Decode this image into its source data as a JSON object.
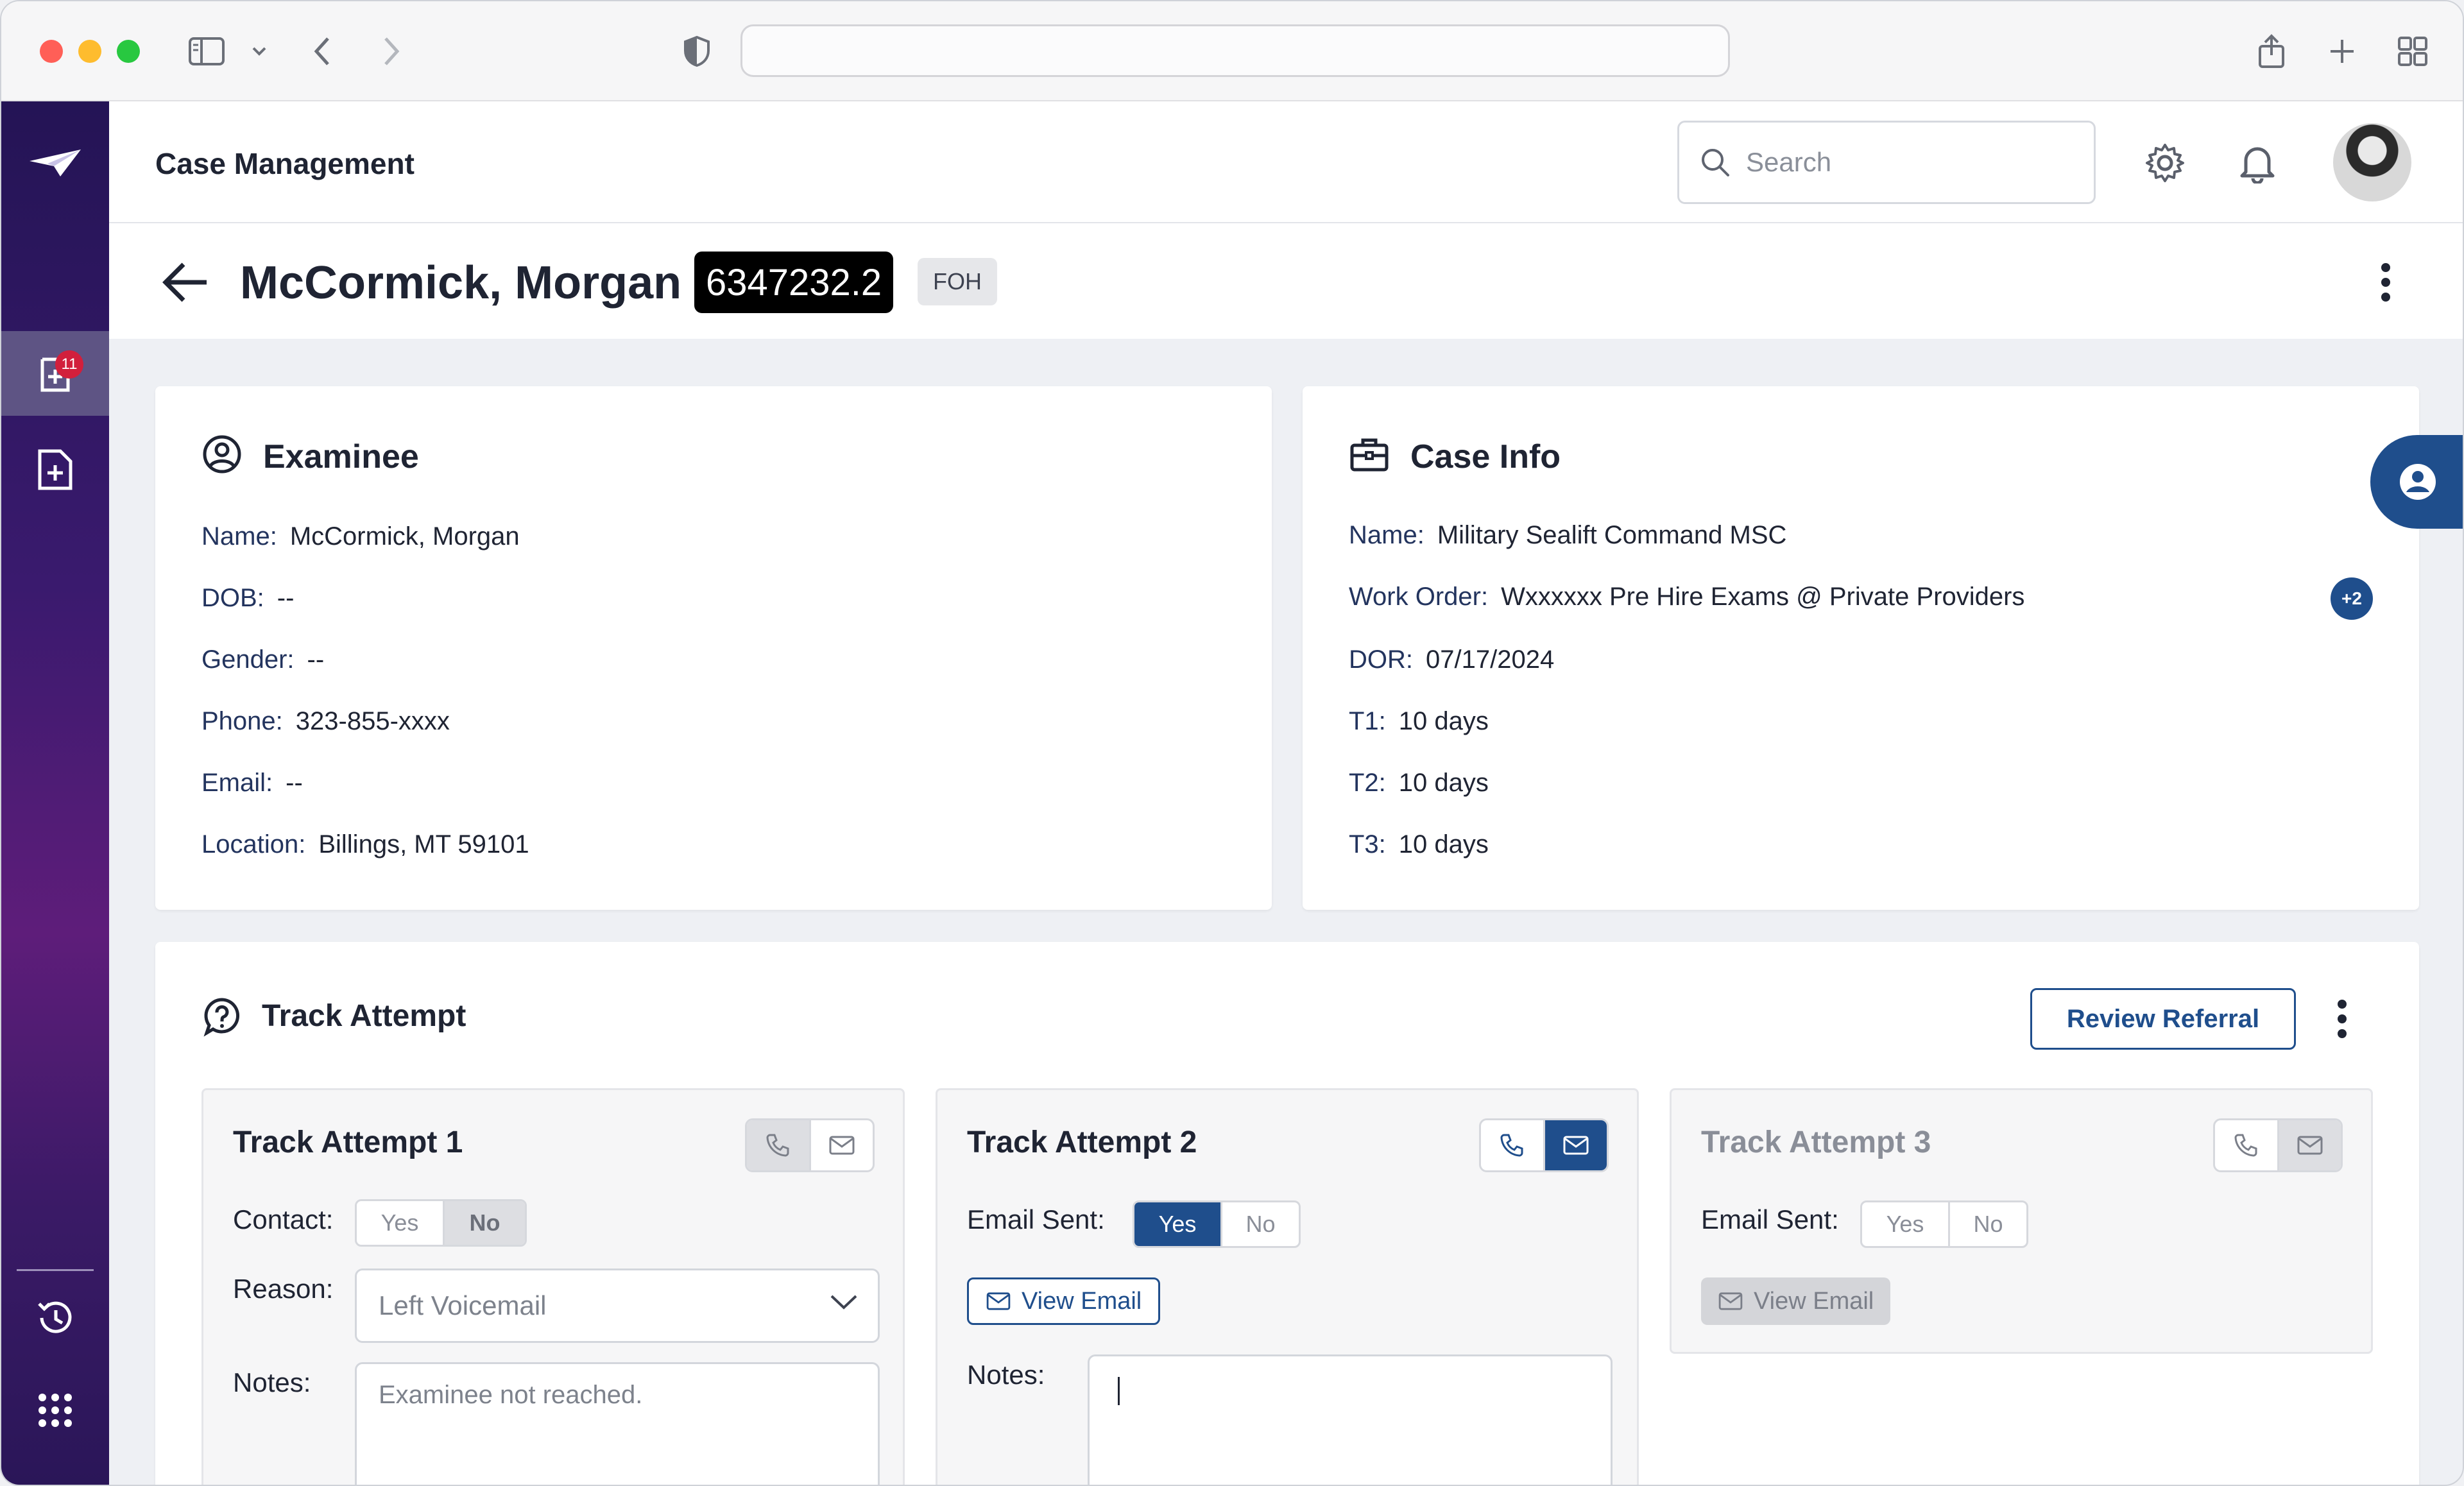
{
  "app": {
    "title": "Case Management",
    "search_placeholder": "Search",
    "nav_badge": "11"
  },
  "case": {
    "person_name": "McCormick, Morgan",
    "case_id": "6347232.2",
    "tag": "FOH"
  },
  "examinee": {
    "title": "Examinee",
    "rows": [
      {
        "label": "Name:",
        "value": "McCormick, Morgan"
      },
      {
        "label": "DOB:",
        "value": "--"
      },
      {
        "label": "Gender:",
        "value": "--"
      },
      {
        "label": "Phone:",
        "value": "323-855-xxxx"
      },
      {
        "label": "Email:",
        "value": "--"
      },
      {
        "label": "Location:",
        "value": "Billings, MT 59101"
      }
    ]
  },
  "case_info": {
    "title": "Case Info",
    "rows": [
      {
        "label": "Name:",
        "value": "Military Sealift Command MSC"
      },
      {
        "label": "Work Order:",
        "value": "Wxxxxxx Pre Hire Exams @ Private Providers"
      },
      {
        "label": "DOR:",
        "value": "07/17/2024"
      },
      {
        "label": "T1:",
        "value": "10 days"
      },
      {
        "label": "T2:",
        "value": "10 days"
      },
      {
        "label": "T3:",
        "value": "10 days"
      }
    ],
    "more_badge": "+2"
  },
  "track": {
    "title": "Track Attempt",
    "review_button": "Review Referral",
    "attempts": [
      {
        "title": "Track Attempt 1",
        "contact_label": "Contact:",
        "yes": "Yes",
        "no": "No",
        "reason_label": "Reason:",
        "reason_value": "Left Voicemail",
        "notes_label": "Notes:",
        "notes_value": "Examinee not reached."
      },
      {
        "title": "Track Attempt 2",
        "email_label": "Email Sent:",
        "yes": "Yes",
        "no": "No",
        "view_email": "View Email",
        "notes_label": "Notes:",
        "notes_value": ""
      },
      {
        "title": "Track Attempt 3",
        "email_label": "Email Sent:",
        "yes": "Yes",
        "no": "No",
        "view_email": "View Email"
      }
    ]
  },
  "colors": {
    "accent": "#1f4e8c",
    "sidebar_top": "#241455",
    "badge": "#d21f3c"
  }
}
